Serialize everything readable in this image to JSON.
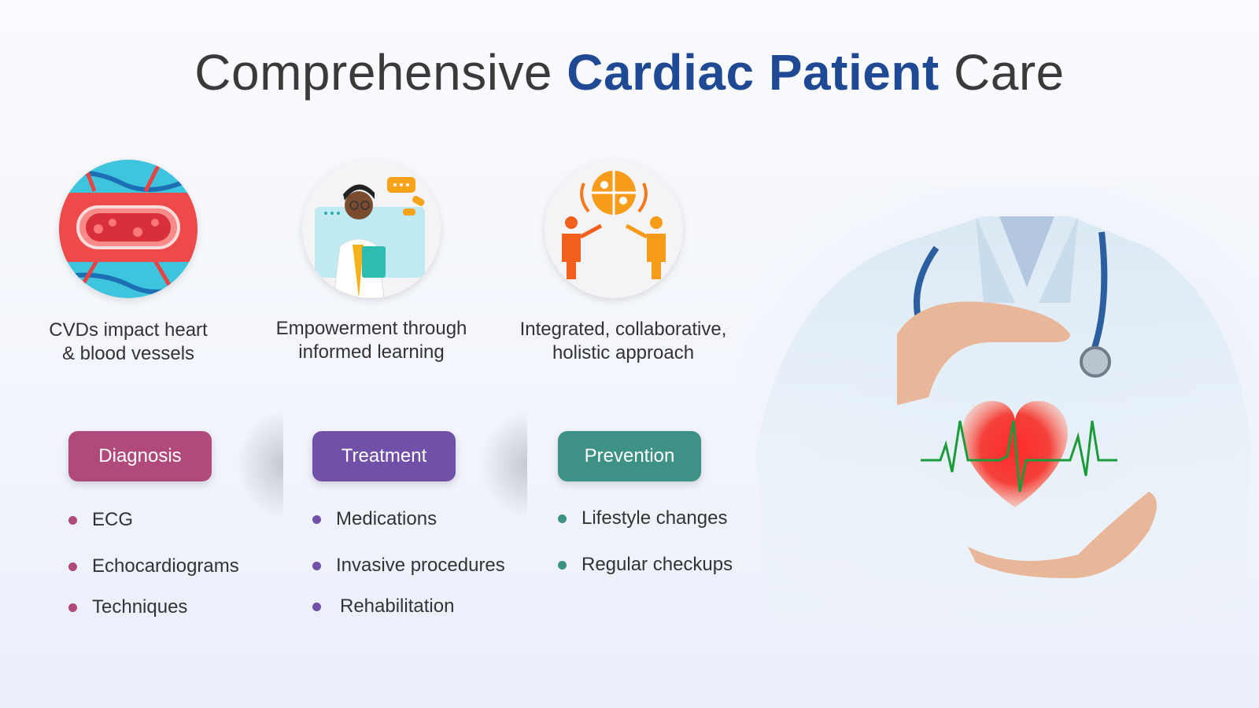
{
  "title": {
    "part1": "Comprehensive ",
    "highlight": "Cardiac Patient",
    "part2": " Care",
    "text_color": "#3a3a3a",
    "highlight_color": "#1f4a93"
  },
  "features": [
    {
      "icon": "blood-vessel-icon",
      "caption_line1": "CVDs impact heart",
      "caption_line2": "& blood vessels"
    },
    {
      "icon": "doctor-education-icon",
      "caption_line1": "Empowerment through",
      "caption_line2": "informed learning"
    },
    {
      "icon": "collaboration-puzzle-icon",
      "caption_line1": "Integrated, collaborative,",
      "caption_line2": "holistic approach"
    }
  ],
  "categories": [
    {
      "label": "Diagnosis",
      "color": "#b04a7a",
      "items": [
        "ECG",
        "Echocardiograms",
        "Techniques"
      ]
    },
    {
      "label": "Treatment",
      "color": "#7150a8",
      "items": [
        "Medications",
        "Invasive procedures",
        "Rehabilitation"
      ]
    },
    {
      "label": "Prevention",
      "color": "#3e9185",
      "items": [
        "Lifestyle changes",
        "Regular checkups"
      ]
    }
  ],
  "photo": {
    "icon": "doctor-holding-heart-image"
  }
}
